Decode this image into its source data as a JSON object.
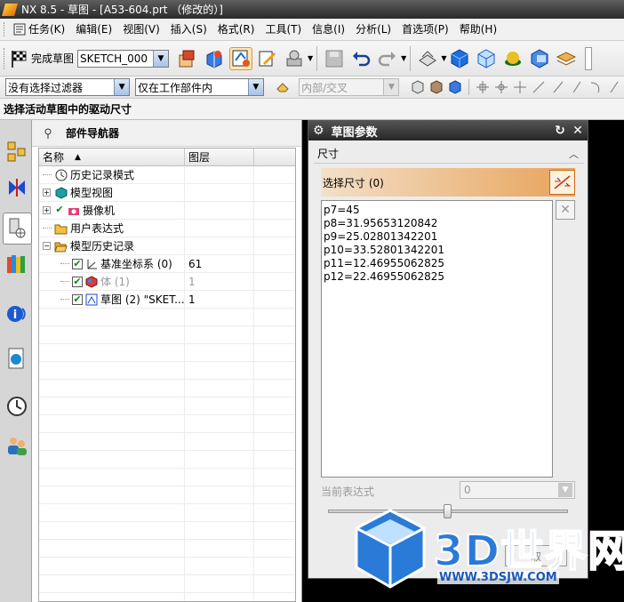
{
  "window": {
    "title": "NX 8.5 - 草图 - [A53-604.prt （修改的）]"
  },
  "menu": [
    {
      "label": "任务(K)",
      "icon": "task-icon"
    },
    {
      "label": "编辑(E)"
    },
    {
      "label": "视图(V)"
    },
    {
      "label": "插入(S)"
    },
    {
      "label": "格式(R)"
    },
    {
      "label": "工具(T)"
    },
    {
      "label": "信息(I)"
    },
    {
      "label": "分析(L)"
    },
    {
      "label": "首选项(P)"
    },
    {
      "label": "帮助(H)"
    }
  ],
  "toolbar": {
    "finish_sketch_label": "完成草图",
    "sketch_name": "SKETCH_000"
  },
  "filters": {
    "type_filter": "没有选择过滤器",
    "scope_filter": "仅在工作部件内",
    "intersect_filter": "内部/交叉"
  },
  "cue_line": "选择活动草图中的驱动尺寸",
  "navigator": {
    "title": "部件导航器",
    "columns": [
      "名称",
      "图层"
    ],
    "rows": [
      {
        "name": "历史记录模式",
        "layer": "",
        "level": 0,
        "expand": "",
        "checked": false,
        "icon": "clock-icon"
      },
      {
        "name": "模型视图",
        "layer": "",
        "level": 0,
        "expand": "+",
        "checked": false,
        "icon": "model-views-icon"
      },
      {
        "name": "摄像机",
        "layer": "",
        "level": 0,
        "expand": "+",
        "checked": true,
        "icon": "camera-icon"
      },
      {
        "name": "用户表达式",
        "layer": "",
        "level": 0,
        "expand": "",
        "checked": false,
        "icon": "folder-icon"
      },
      {
        "name": "模型历史记录",
        "layer": "",
        "level": 0,
        "expand": "-",
        "checked": false,
        "icon": "folder-open-icon"
      },
      {
        "name": "基准坐标系 (0)",
        "layer": "61",
        "level": 1,
        "expand": "",
        "checked": true,
        "icon": "datum-csys-icon"
      },
      {
        "name": "体 (1)",
        "layer": "1",
        "level": 1,
        "expand": "",
        "checked": true,
        "icon": "body-icon",
        "dim": true
      },
      {
        "name": "草图 (2) \"SKET...",
        "layer": "1",
        "level": 1,
        "expand": "",
        "checked": true,
        "icon": "sketch-icon"
      }
    ]
  },
  "dialog": {
    "title": "草图参数",
    "group_label": "尺寸",
    "select_label": "选择尺寸 (0)",
    "dimensions": [
      "p7=45",
      "p8=31.95653120842",
      "p9=25.02801342201",
      "p10=33.52801342201",
      "p11=12.46955062825",
      "p12=22.46955062825"
    ],
    "current_expression_label": "当前表达式",
    "current_expression_value": "0",
    "slider_value": 0.5,
    "cancel_partial": "取"
  },
  "watermark": {
    "brand": "3D世界网",
    "url": "WWW.3DSJW.COM"
  }
}
